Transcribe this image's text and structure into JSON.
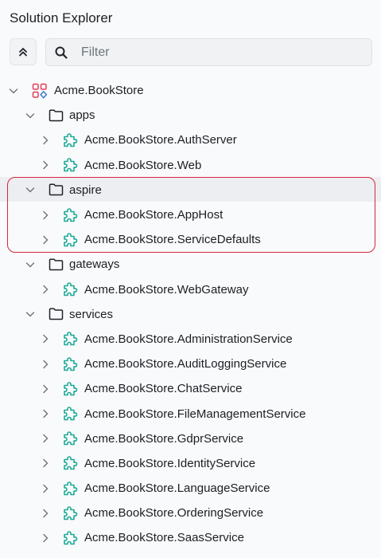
{
  "panel": {
    "title": "Solution Explorer",
    "filter_placeholder": "Filter",
    "filter_value": ""
  },
  "colors": {
    "accent_icon": "#1cab98",
    "solution_red": "#e0405a",
    "solution_blue": "#3a7bd5",
    "highlight_border": "#d7263d"
  },
  "tree": {
    "solution": {
      "label": "Acme.BookStore",
      "expanded": true,
      "icon": "solution-icon"
    },
    "folders": [
      {
        "label": "apps",
        "expanded": true,
        "icon": "folder-icon",
        "projects": [
          {
            "label": "Acme.BookStore.AuthServer",
            "icon": "module-icon"
          },
          {
            "label": "Acme.BookStore.Web",
            "icon": "module-icon"
          }
        ]
      },
      {
        "label": "aspire",
        "expanded": true,
        "selected": true,
        "icon": "folder-icon",
        "projects": [
          {
            "label": "Acme.BookStore.AppHost",
            "icon": "module-icon"
          },
          {
            "label": "Acme.BookStore.ServiceDefaults",
            "icon": "module-icon"
          }
        ]
      },
      {
        "label": "gateways",
        "expanded": true,
        "icon": "folder-icon",
        "projects": [
          {
            "label": "Acme.BookStore.WebGateway",
            "icon": "module-icon"
          }
        ]
      },
      {
        "label": "services",
        "expanded": true,
        "icon": "folder-icon",
        "projects": [
          {
            "label": "Acme.BookStore.AdministrationService",
            "icon": "module-icon"
          },
          {
            "label": "Acme.BookStore.AuditLoggingService",
            "icon": "module-icon"
          },
          {
            "label": "Acme.BookStore.ChatService",
            "icon": "module-icon"
          },
          {
            "label": "Acme.BookStore.FileManagementService",
            "icon": "module-icon"
          },
          {
            "label": "Acme.BookStore.GdprService",
            "icon": "module-icon"
          },
          {
            "label": "Acme.BookStore.IdentityService",
            "icon": "module-icon"
          },
          {
            "label": "Acme.BookStore.LanguageService",
            "icon": "module-icon"
          },
          {
            "label": "Acme.BookStore.OrderingService",
            "icon": "module-icon"
          },
          {
            "label": "Acme.BookStore.SaasService",
            "icon": "module-icon"
          }
        ]
      }
    ]
  }
}
